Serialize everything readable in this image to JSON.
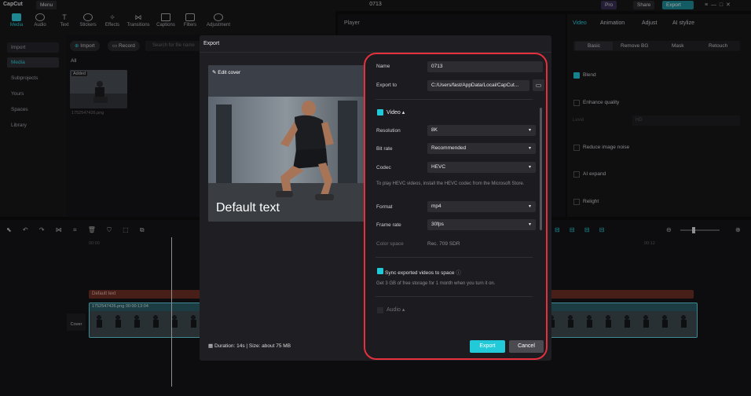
{
  "app": {
    "logo": "CapCut",
    "menu": "Menu",
    "title": "0713",
    "pro": "Pro",
    "share": "Share",
    "export": "Export"
  },
  "toolbar": [
    "Media",
    "Audio",
    "Text",
    "Stickers",
    "Effects",
    "Transitions",
    "Captions",
    "Filters",
    "Adjustment"
  ],
  "left_nav": [
    "Import",
    "Media",
    "Subprojects",
    "Yours",
    "Spaces",
    "Library"
  ],
  "media": {
    "import_btn": "Import",
    "record_btn": "Record",
    "search_placeholder": "Search for file name",
    "all": "All",
    "added": "Added",
    "file": "1752547426.png"
  },
  "player": {
    "title": "Player"
  },
  "right": {
    "tabs": [
      "Video",
      "Animation",
      "Adjust",
      "AI stylize"
    ],
    "subtabs": [
      "Basic",
      "Remove BG",
      "Mask",
      "Retouch"
    ],
    "items": [
      "Blend",
      "Enhance quality",
      "Level",
      "HD",
      "Reduce image noise",
      "AI expand",
      "Relight"
    ]
  },
  "timeline": {
    "cover": "Cover",
    "time_a": "00:00",
    "time_b": "00:12",
    "text_track": "Default text",
    "clip": "1752547426.png  00:00:13:04"
  },
  "modal": {
    "title": "Export",
    "edit_cover": "Edit cover",
    "default_text": "Default text",
    "duration": "Duration: 14s | Size: about 75 MB",
    "name_label": "Name",
    "name_value": "0713",
    "export_to_label": "Export to",
    "export_to_value": "C:/Users/fast/AppData/Local/CapCut...",
    "video_label": "Video",
    "resolution_label": "Resolution",
    "resolution_value": "8K",
    "bitrate_label": "Bit rate",
    "bitrate_value": "Recommended",
    "codec_label": "Codec",
    "codec_value": "HEVC",
    "codec_note": "To play HEVC videos, install the HEVC codec from the Microsoft Store.",
    "format_label": "Format",
    "format_value": "mp4",
    "framerate_label": "Frame rate",
    "framerate_value": "30fps",
    "colorspace_label": "Color space",
    "colorspace_value": "Rec. 709 SDR",
    "sync_label": "Sync exported videos to space",
    "sync_note": "Get 3 GB of free storage for 1 month when you turn it on.",
    "audio_label": "Audio",
    "export_btn": "Export",
    "cancel_btn": "Cancel"
  },
  "colors": {
    "accent": "#22c9d8",
    "highlight": "#e5303d"
  }
}
